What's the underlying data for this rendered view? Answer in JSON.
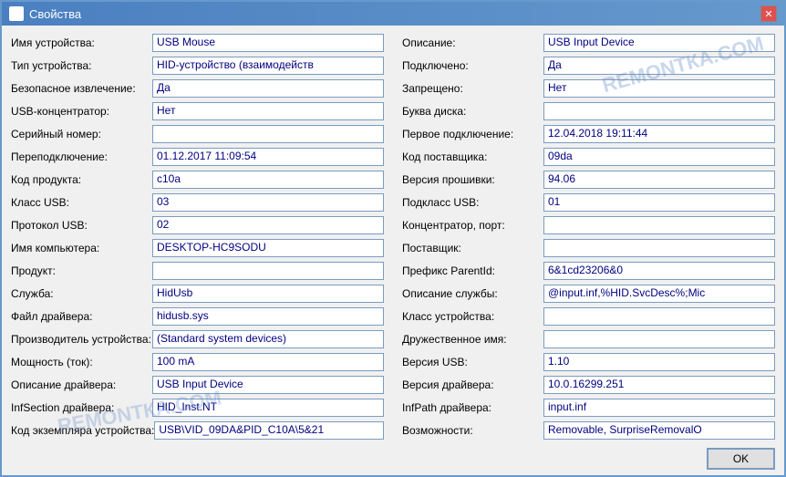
{
  "window": {
    "title": "Свойства",
    "close_btn": "✕",
    "watermark1": "REMONТКА.COM",
    "watermark2": "REMONТКА.COM"
  },
  "footer": {
    "ok_label": "OK"
  },
  "left_column": [
    {
      "label": "Имя устройства:",
      "value": "USB Mouse"
    },
    {
      "label": "Тип устройства:",
      "value": "HID-устройство (взаимодейств"
    },
    {
      "label": "Безопасное извлечение:",
      "value": "Да"
    },
    {
      "label": "USB-концентратор:",
      "value": "Нет"
    },
    {
      "label": "Серийный номер:",
      "value": ""
    },
    {
      "label": "Переподключение:",
      "value": "01.12.2017 11:09:54"
    },
    {
      "label": "Код продукта:",
      "value": "c10a"
    },
    {
      "label": "Класс USB:",
      "value": "03"
    },
    {
      "label": "Протокол USB:",
      "value": "02"
    },
    {
      "label": "Имя компьютера:",
      "value": "DESKTOP-HC9SODU"
    },
    {
      "label": "Продукт:",
      "value": ""
    },
    {
      "label": "Служба:",
      "value": "HidUsb"
    },
    {
      "label": "Файл драйвера:",
      "value": "hidusb.sys"
    },
    {
      "label": "Производитель устройства:",
      "value": "(Standard system devices)"
    },
    {
      "label": "Мощность (ток):",
      "value": "100 mA"
    },
    {
      "label": "Описание драйвера:",
      "value": "USB Input Device"
    },
    {
      "label": "InfSection драйвера:",
      "value": "HID_Inst.NT"
    },
    {
      "label": "Код экземпляра устройства:",
      "value": "USB\\VID_09DA&PID_C10A\\5&21"
    }
  ],
  "right_column": [
    {
      "label": "Описание:",
      "value": "USB Input Device"
    },
    {
      "label": "Подключено:",
      "value": "Да"
    },
    {
      "label": "Запрещено:",
      "value": "Нет"
    },
    {
      "label": "Буква диска:",
      "value": ""
    },
    {
      "label": "Первое подключение:",
      "value": "12.04.2018 19:11:44"
    },
    {
      "label": "Код поставщика:",
      "value": "09da"
    },
    {
      "label": "Версия прошивки:",
      "value": "94.06"
    },
    {
      "label": "Подкласс USB:",
      "value": "01"
    },
    {
      "label": "Концентратор, порт:",
      "value": ""
    },
    {
      "label": "Поставщик:",
      "value": ""
    },
    {
      "label": "Префикс ParentId:",
      "value": "6&1cd23206&0"
    },
    {
      "label": "Описание службы:",
      "value": "@input.inf,%HID.SvcDesc%;Mic"
    },
    {
      "label": "Класс устройства:",
      "value": ""
    },
    {
      "label": "Дружественное имя:",
      "value": ""
    },
    {
      "label": "Версия USB:",
      "value": "1.10"
    },
    {
      "label": "Версия драйвера:",
      "value": "10.0.16299.251"
    },
    {
      "label": "InfPath драйвера:",
      "value": "input.inf"
    },
    {
      "label": "Возможности:",
      "value": "Removable, SurpriseRemovalO"
    }
  ]
}
